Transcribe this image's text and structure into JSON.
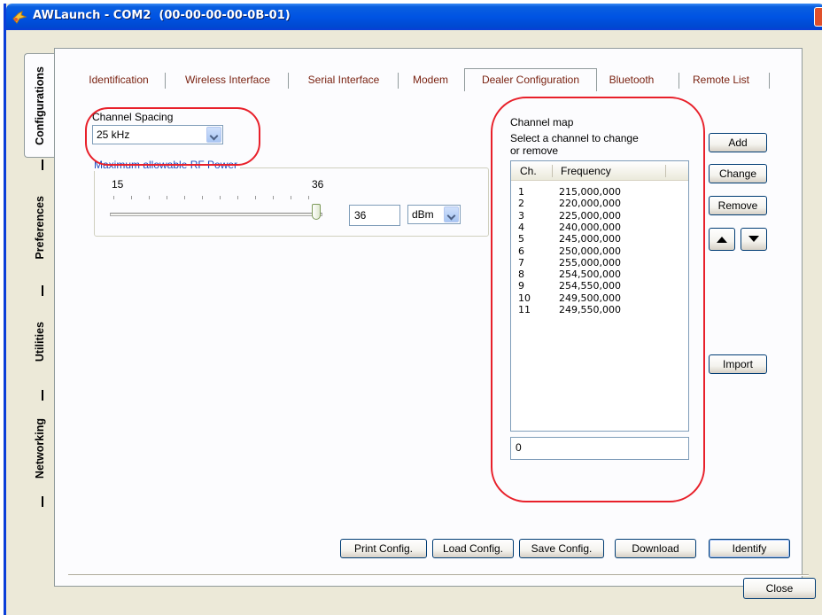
{
  "window": {
    "title": "AWLaunch - COM2  (00-00-00-00-0B-01)"
  },
  "side_tabs": [
    {
      "label": "Configurations",
      "active": true
    },
    {
      "label": "Preferences",
      "active": false
    },
    {
      "label": "Utilities",
      "active": false
    },
    {
      "label": "Networking",
      "active": false
    }
  ],
  "top_tabs": [
    {
      "label": "Identification",
      "active": false
    },
    {
      "label": "Wireless Interface",
      "active": false
    },
    {
      "label": "Serial Interface",
      "active": false
    },
    {
      "label": "Modem",
      "active": false
    },
    {
      "label": "Dealer Configuration",
      "active": true
    },
    {
      "label": "Bluetooth",
      "active": false
    },
    {
      "label": "Remote List",
      "active": false
    }
  ],
  "channel_spacing": {
    "label": "Channel Spacing",
    "value": "25 kHz"
  },
  "rf_power": {
    "label": "Maximum allowable RF Power",
    "min_label": "15",
    "max_label": "36",
    "value": "36",
    "level": 1.0,
    "unit": "dBm"
  },
  "channel_map": {
    "title": "Channel map",
    "instruction_line1": "Select a channel to change",
    "instruction_line2": "or remove",
    "col_channel": "Ch.",
    "col_frequency": "Frequency",
    "rows": [
      {
        "ch": "1",
        "freq": "215,000,000"
      },
      {
        "ch": "2",
        "freq": "220,000,000"
      },
      {
        "ch": "3",
        "freq": "225,000,000"
      },
      {
        "ch": "4",
        "freq": "240,000,000"
      },
      {
        "ch": "5",
        "freq": "245,000,000"
      },
      {
        "ch": "6",
        "freq": "250,000,000"
      },
      {
        "ch": "7",
        "freq": "255,000,000"
      },
      {
        "ch": "8",
        "freq": "254,500,000"
      },
      {
        "ch": "9",
        "freq": "254,550,000"
      },
      {
        "ch": "10",
        "freq": "249,500,000"
      },
      {
        "ch": "11",
        "freq": "249,550,000"
      }
    ],
    "entry_value": "0"
  },
  "buttons": {
    "add": "Add",
    "change": "Change",
    "remove": "Remove",
    "import": "Import",
    "print_config": "Print Config.",
    "load_config": "Load Config.",
    "save_config": "Save Config.",
    "download": "Download",
    "identify": "Identify",
    "close": "Close"
  },
  "colors": {
    "highlight_oval": "#e8202a",
    "tab_text": "#7a2312",
    "group_label": "#1c4bbd",
    "titlebar": "#0054e3"
  }
}
